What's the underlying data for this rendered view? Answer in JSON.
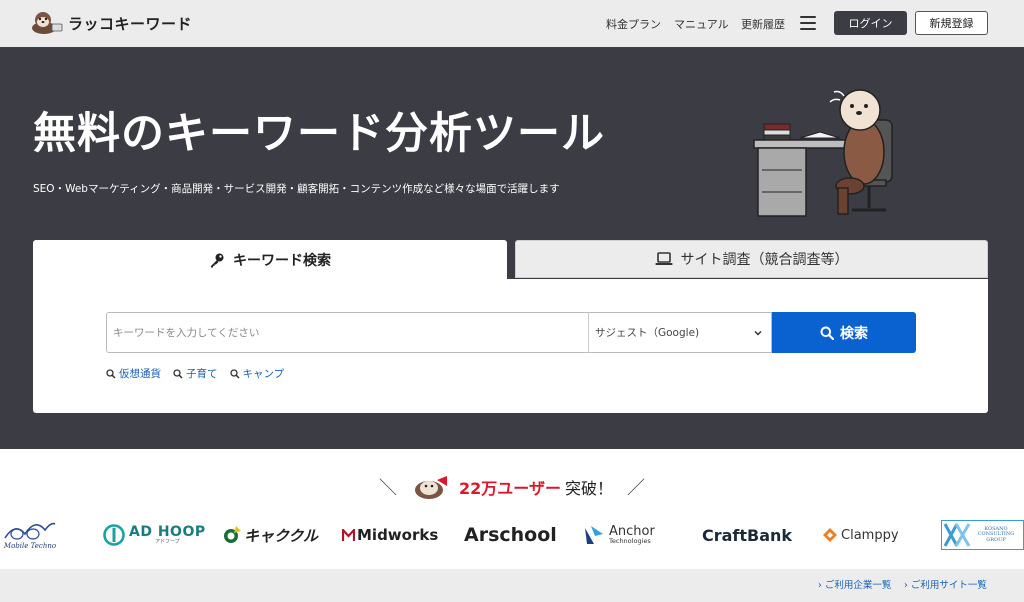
{
  "header": {
    "logo_text": "ラッコキーワード",
    "nav": [
      "料金プラン",
      "マニュアル",
      "更新履歴"
    ],
    "login_label": "ログイン",
    "signup_label": "新規登録"
  },
  "hero": {
    "title": "無料のキーワード分析ツール",
    "subtitle": "SEO・Webマーケティング・商品開発・サービス開発・顧客開拓・コンテンツ作成など様々な場面で活躍します"
  },
  "tabs": {
    "keyword_label": "キーワード検索",
    "site_label": "サイト調査（競合調査等）"
  },
  "search": {
    "placeholder": "キーワードを入力してください",
    "select_value": "サジェスト（Google)",
    "button_label": "検索",
    "suggestions": [
      "仮想通貨",
      "子育て",
      "キャンプ"
    ]
  },
  "users": {
    "count_text": "22万ユーザー",
    "suffix": "突破！",
    "slash_left": "＼",
    "slash_right": "／"
  },
  "logos": {
    "mobile_techno": "Mobile Techno",
    "adhoop": "AD HOOP",
    "adhoop_sub": "アドフープ",
    "cyakukuru": "キャククル",
    "midworks": "Midworks",
    "arschool": "Arschool",
    "anchor": "Anchor",
    "anchor_sub": "Technologies",
    "craftbank": "CraftBank",
    "clamppy": "Clamppy",
    "kosano": "KOSANO CONSULTING GROUP"
  },
  "footer": {
    "links": [
      "ご利用企業一覧",
      "ご利用サイト一覧"
    ]
  },
  "colors": {
    "hero_bg": "#3b3c44",
    "accent_blue": "#0a62d1",
    "highlight_red": "#d9182b",
    "header_bg": "#ececec"
  }
}
